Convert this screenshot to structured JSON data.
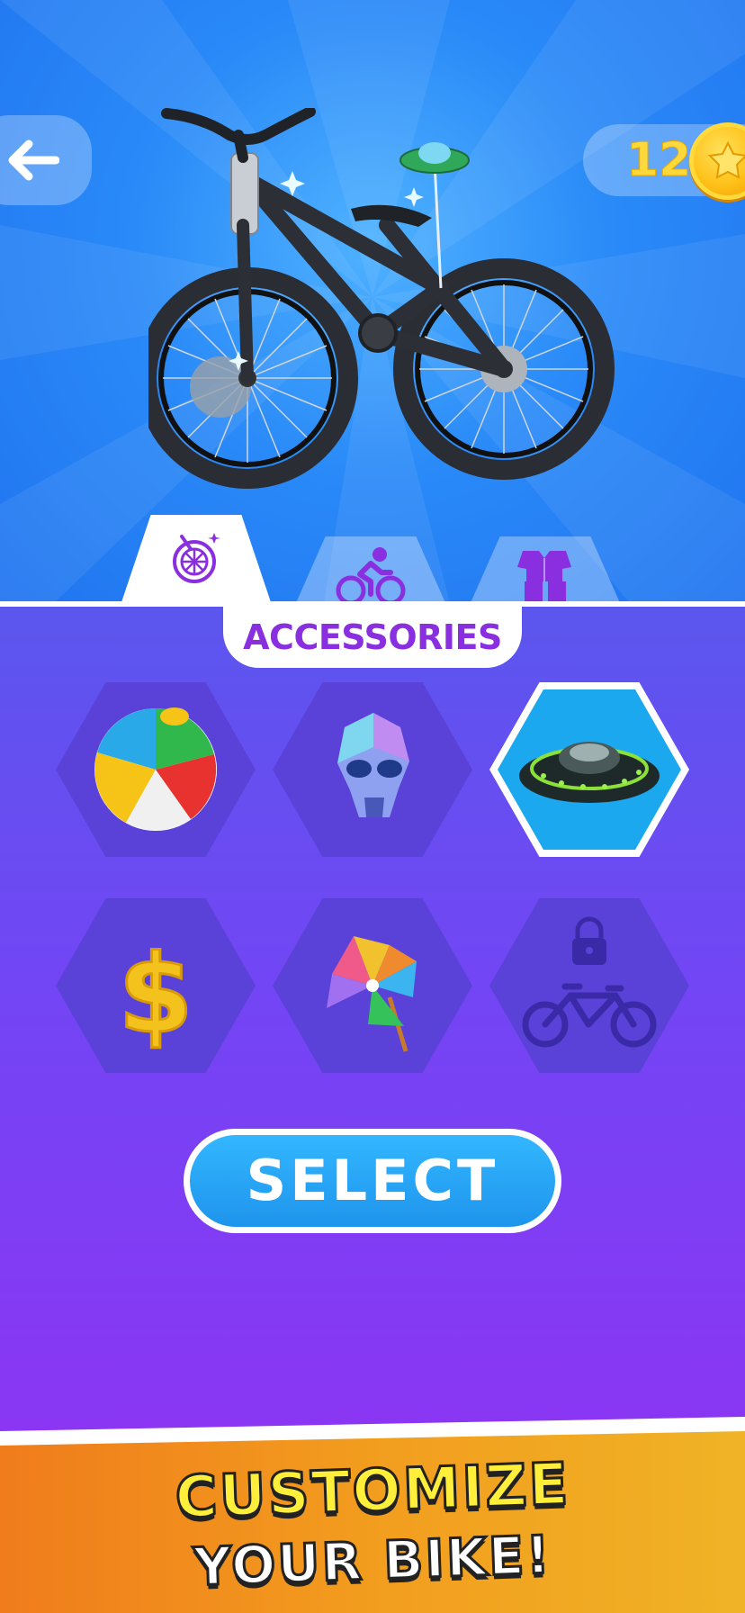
{
  "header": {
    "back_icon": "arrow-left-icon",
    "coins": "12",
    "coin_icon": "coin-icon",
    "coin_color": "#ffd93b"
  },
  "tabs": [
    {
      "icon": "wheel-sparkle-icon",
      "active": true
    },
    {
      "icon": "cyclist-icon",
      "active": false
    },
    {
      "icon": "outfit-icon",
      "active": false
    }
  ],
  "section": {
    "title": "ACCESSORIES",
    "title_color": "#8a2fe0"
  },
  "items": [
    {
      "icon": "beach-ball-icon",
      "selected": false,
      "locked": false
    },
    {
      "icon": "skull-icon",
      "selected": false,
      "locked": false
    },
    {
      "icon": "ufo-icon",
      "selected": true,
      "locked": false
    },
    {
      "icon": "dollar-sign-icon",
      "selected": false,
      "locked": false
    },
    {
      "icon": "pinwheel-icon",
      "selected": false,
      "locked": false
    },
    {
      "icon": "locked-bike-icon",
      "selected": false,
      "locked": true
    }
  ],
  "actions": {
    "select_label": "SELECT"
  },
  "banner": {
    "line1": "CUSTOMIZE",
    "line2": "YOUR BIKE!"
  },
  "colors": {
    "top_bg": "#2a8af8",
    "bottom_bg": "#7246f4",
    "select_button": "#1e94ec",
    "hex_tile": "#5a41d8",
    "hex_selected": "#1ba8ef"
  }
}
